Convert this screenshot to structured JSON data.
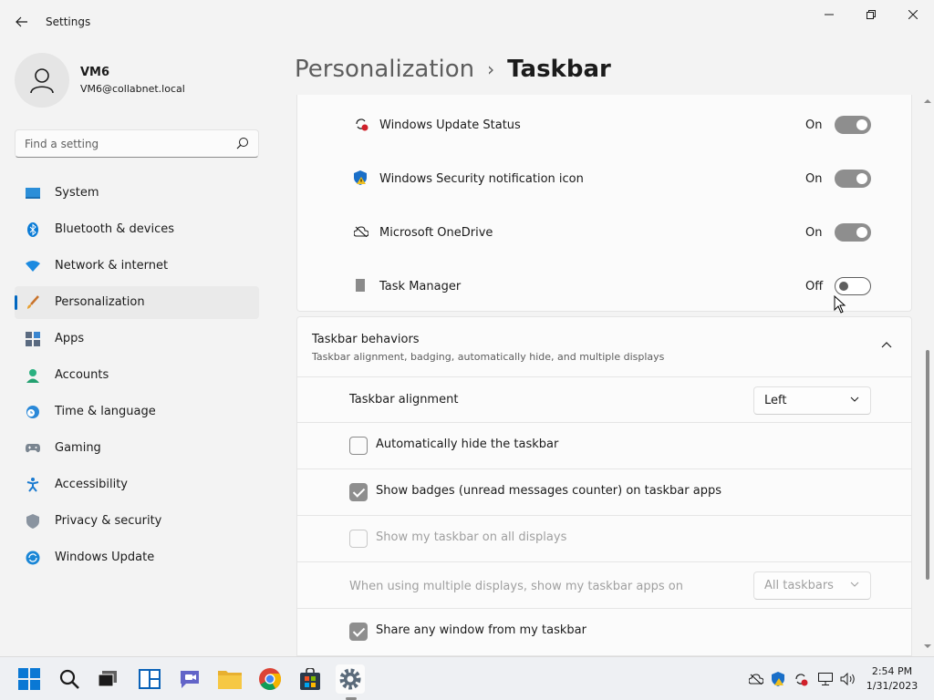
{
  "window": {
    "title": "Settings",
    "colors": {
      "accent": "#0067c0",
      "toggle_on": "#8e8e8e"
    }
  },
  "user": {
    "name": "VM6",
    "email": "VM6@collabnet.local"
  },
  "search": {
    "placeholder": "Find a setting"
  },
  "sidebar": {
    "items": [
      {
        "label": "System",
        "icon": "monitor-icon"
      },
      {
        "label": "Bluetooth & devices",
        "icon": "bluetooth-icon"
      },
      {
        "label": "Network & internet",
        "icon": "wifi-icon"
      },
      {
        "label": "Personalization",
        "icon": "brush-icon",
        "active": true
      },
      {
        "label": "Apps",
        "icon": "apps-icon"
      },
      {
        "label": "Accounts",
        "icon": "person-icon"
      },
      {
        "label": "Time & language",
        "icon": "clock-globe-icon"
      },
      {
        "label": "Gaming",
        "icon": "gamepad-icon"
      },
      {
        "label": "Accessibility",
        "icon": "accessibility-icon"
      },
      {
        "label": "Privacy & security",
        "icon": "shield-icon"
      },
      {
        "label": "Windows Update",
        "icon": "update-icon"
      }
    ]
  },
  "breadcrumb": {
    "parent": "Personalization",
    "separator": "›",
    "current": "Taskbar"
  },
  "tray_items": [
    {
      "label": "Windows Update Status",
      "state": "On",
      "on": true,
      "icon": "update-status-icon"
    },
    {
      "label": "Windows Security notification icon",
      "state": "On",
      "on": true,
      "icon": "security-shield-icon"
    },
    {
      "label": "Microsoft OneDrive",
      "state": "On",
      "on": true,
      "icon": "onedrive-offline-icon"
    },
    {
      "label": "Task Manager",
      "state": "Off",
      "on": false,
      "icon": "task-manager-icon"
    }
  ],
  "behaviors": {
    "title": "Taskbar behaviors",
    "subtitle": "Taskbar alignment, badging, automatically hide, and multiple displays",
    "alignment": {
      "label": "Taskbar alignment",
      "value": "Left"
    },
    "auto_hide": {
      "label": "Automatically hide the taskbar",
      "checked": false
    },
    "badges": {
      "label": "Show badges (unread messages counter) on taskbar apps",
      "checked": true
    },
    "all_displays": {
      "label": "Show my taskbar on all displays",
      "checked": false,
      "disabled": true
    },
    "multi_display": {
      "label": "When using multiple displays, show my taskbar apps on",
      "value": "All taskbars",
      "disabled": true
    },
    "share_window": {
      "label": "Share any window from my taskbar",
      "checked": true
    }
  },
  "taskbar": {
    "apps": [
      "start-icon",
      "search-icon",
      "task-view-icon",
      "widgets-icon",
      "teams-chat-icon",
      "file-explorer-icon",
      "chrome-icon",
      "store-icon",
      "settings-icon"
    ],
    "clock": {
      "time": "2:54 PM",
      "date": "1/31/2023"
    }
  }
}
